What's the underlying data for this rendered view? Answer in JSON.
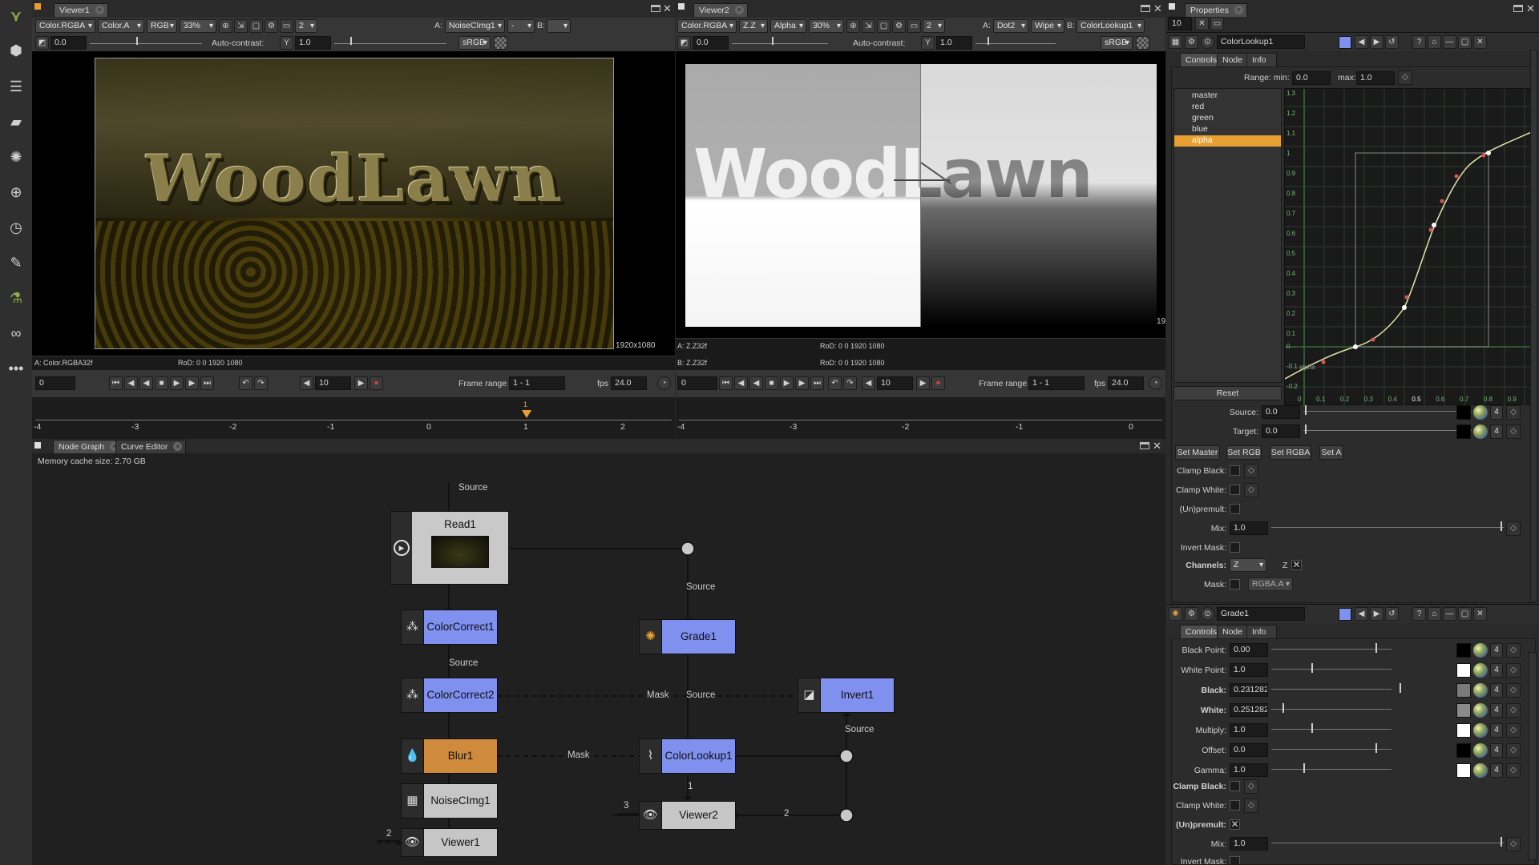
{
  "colors": {
    "accent_orange": "#e8a032",
    "node_blue": "#7f90ee",
    "node_gray": "#c6c6c6",
    "node_orange": "#d08a3c",
    "bg": "#262626"
  },
  "sidebar": {
    "items": [
      "merge-icon",
      "channel-icon",
      "color-icon",
      "filter-icon",
      "keyer-icon",
      "transform-icon",
      "time-icon",
      "paint-icon",
      "views-icon",
      "infinity-icon",
      "more-icon"
    ]
  },
  "viewer1": {
    "tab": "Viewer1",
    "layer": "Color.RGBA",
    "channel": "Color.A",
    "display": "RGB",
    "zoom": "33%",
    "proxy": "2",
    "a_label": "A:",
    "a_input": "NoiseCImg1",
    "wipe": "-",
    "b_label": "B:",
    "b_input": "",
    "gain": "0.0",
    "gain_ticks": [
      "-2",
      "-1",
      "0",
      "1",
      "2",
      "3",
      "4",
      "5"
    ],
    "autocontrast": "Auto-contrast:",
    "gamma_icon": "Y",
    "gamma": "1.0",
    "gamma_ticks": [
      "0.5",
      "1",
      "1.5",
      "2",
      "2.5",
      "3",
      "3.5",
      "4"
    ],
    "colorspace": "sRGB",
    "resolution": "1920x1080",
    "info_left": "A: Color.RGBA32f",
    "info_rod": "RoD: 0 0 1920 1080",
    "image_text": "WoodLawn",
    "start_frame": "0",
    "step": "10",
    "frame_range_label": "Frame range",
    "frame_range": "1 - 1",
    "fps_label": "fps",
    "fps": "24.0",
    "timeline_ticks": [
      "-4",
      "-3",
      "-2",
      "-1",
      "0",
      "1",
      "2"
    ],
    "current_frame": "1"
  },
  "viewer2": {
    "tab": "Viewer2",
    "layer": "Color.RGBA",
    "channel": "Z.Z",
    "display": "Alpha",
    "zoom": "30%",
    "proxy": "2",
    "a_label": "A:",
    "a_input": "Dot2",
    "wipe": "Wipe",
    "b_label": "B:",
    "b_input": "ColorLookup1",
    "gain": "0.0",
    "autocontrast": "Auto-contrast:",
    "gamma_icon": "Y",
    "gamma": "1.0",
    "colorspace": "sRGB",
    "edge_text": "19",
    "info_a": "A: Z.Z32f",
    "info_b": "B: Z.Z32f",
    "info_rod": "RoD: 0 0 1920 1080",
    "image_text": "WoodLawn",
    "start_frame": "0",
    "step": "10",
    "frame_range_label": "Frame range",
    "frame_range": "1 - 1",
    "fps_label": "fps",
    "fps": "24.0",
    "timeline_ticks": [
      "-4",
      "-3",
      "-2",
      "-1",
      "0"
    ]
  },
  "nodegraph": {
    "tabs": [
      "Node Graph",
      "Curve Editor"
    ],
    "memory": "Memory cache size: 2.70 GB",
    "nodes": {
      "read": "Read1",
      "cc1": "ColorCorrect1",
      "cc2": "ColorCorrect2",
      "blur": "Blur1",
      "noise": "NoiseCImg1",
      "viewer1": "Viewer1",
      "grade": "Grade1",
      "lookup": "ColorLookup1",
      "viewer2": "Viewer2",
      "invert": "Invert1"
    },
    "edge_labels": {
      "source_top": "Source",
      "source_cc": "Source",
      "source_grade": "Source",
      "mask_cc2": "Mask",
      "source_mid": "Source",
      "mask_blur": "Mask",
      "source_invert": "Source",
      "input1": "1",
      "input2": "2",
      "input3": "3",
      "viewer1_input": "2"
    }
  },
  "properties": {
    "tab": "Properties",
    "max_panels": "10",
    "lookup": {
      "name": "ColorLookup1",
      "tabs": [
        "Controls",
        "Node",
        "Info"
      ],
      "range_min_label": "Range: min:",
      "range_min": "0.0",
      "range_max_label": "max:",
      "range_max": "1.0",
      "curves": [
        "master",
        "red",
        "green",
        "blue",
        "alpha"
      ],
      "selected_curve": "alpha",
      "reset": "Reset",
      "graph_y_ticks": [
        "1.3",
        "1.2",
        "1.1",
        "1",
        "0.9",
        "0.8",
        "0.7",
        "0.6",
        "0.5",
        "0.4",
        "0.3",
        "0.2",
        "0.1",
        "0",
        "-0.1",
        "-0.2"
      ],
      "graph_x_ticks": [
        "0",
        "0.1",
        "0.2",
        "0.3",
        "0.4",
        "0.5",
        "0.6",
        "0.7",
        "0.8",
        "0.9",
        "1"
      ],
      "graph_curve_label": "alpha",
      "source_label": "Source:",
      "source": "0.0",
      "target_label": "Target:",
      "target": "0.0",
      "buttons": [
        "Set Master",
        "Set RGB",
        "Set RGBA",
        "Set A"
      ],
      "clamp_black": "Clamp Black:",
      "clamp_white": "Clamp White:",
      "unpremult": "(Un)premult:",
      "mix_label": "Mix:",
      "mix": "1.0",
      "invert_mask": "Invert Mask:",
      "channels_label": "Channels:",
      "channels": "Z",
      "channels_z": "Z",
      "mask_label": "Mask:",
      "mask_channel": "RGBA.A",
      "four": "4"
    },
    "grade": {
      "name": "Grade1",
      "tabs": [
        "Controls",
        "Node",
        "Info"
      ],
      "rows": [
        {
          "label": "Black Point:",
          "value": "0.00",
          "swatch": "#000000"
        },
        {
          "label": "White Point:",
          "value": "1.0",
          "swatch": "#ffffff"
        },
        {
          "label": "Black:",
          "value": "0.231282",
          "swatch": "#7a7a7a"
        },
        {
          "label": "White:",
          "value": "0.251282",
          "swatch": "#8a8a8a"
        },
        {
          "label": "Multiply:",
          "value": "1.0",
          "swatch": "#ffffff"
        },
        {
          "label": "Offset:",
          "value": "0.0",
          "swatch": "#000000"
        },
        {
          "label": "Gamma:",
          "value": "1.0",
          "swatch": "#ffffff"
        }
      ],
      "clamp_black": "Clamp Black:",
      "clamp_white": "Clamp White:",
      "unpremult": "(Un)premult:",
      "mix_label": "Mix:",
      "mix": "1.0",
      "invert_mask": "Invert Mask:",
      "four": "4"
    }
  }
}
